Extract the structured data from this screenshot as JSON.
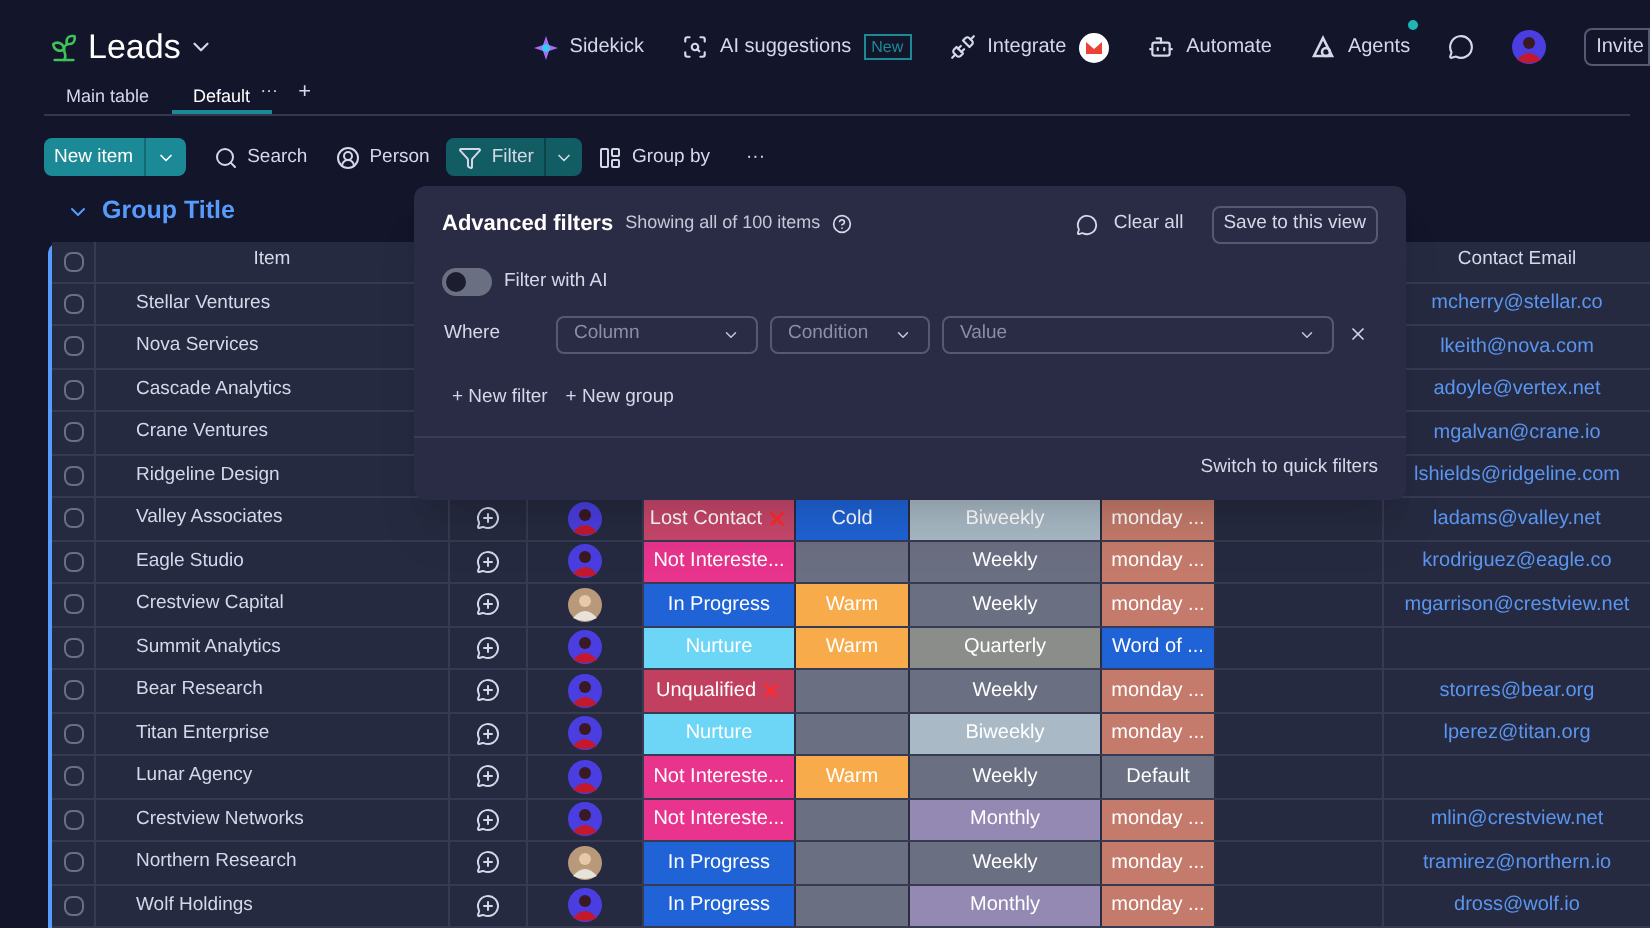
{
  "board": {
    "title": "Leads"
  },
  "top_actions": [
    {
      "label": "Sidekick",
      "kind": "sidekick"
    },
    {
      "label": "AI suggestions",
      "kind": "ai",
      "badge": "New"
    },
    {
      "label": "Integrate",
      "kind": "integrate"
    },
    {
      "label": "Automate",
      "kind": "automate"
    },
    {
      "label": "Agents",
      "kind": "agents"
    }
  ],
  "invite": "Invite",
  "views": [
    {
      "label": "Main table",
      "selected": false
    },
    {
      "label": "Default",
      "selected": true
    }
  ],
  "view_menu": "···",
  "add_view": "+",
  "toolbar": {
    "new_item": "New item",
    "more": "···",
    "items": [
      {
        "label": "Search",
        "kind": "search",
        "selected": false
      },
      {
        "label": "Person",
        "kind": "person",
        "selected": false
      },
      {
        "label": "Filter",
        "kind": "filter",
        "selected": true
      },
      {
        "label": "Group by",
        "kind": "group",
        "selected": false
      }
    ]
  },
  "group": {
    "title": "Group Title",
    "item_header": "Item",
    "email_header": "Contact Email",
    "all_checked": false,
    "rows": [
      {
        "name": "Stellar Ventures",
        "checked": false,
        "email": "mcherry@stellar.co"
      },
      {
        "name": "Nova Services",
        "checked": false,
        "email": "lkeith@nova.com"
      },
      {
        "name": "Cascade Analytics",
        "checked": false,
        "email": "adoyle@vertex.net"
      },
      {
        "name": "Crane Ventures",
        "checked": false,
        "email": "mgalvan@crane.io"
      },
      {
        "name": "Ridgeline Design",
        "checked": false,
        "email": "lshields@ridgeline.com"
      },
      {
        "name": "Valley Associates",
        "checked": false,
        "person": {
          "kind": "purple"
        },
        "status": {
          "label": "Lost Contact",
          "color": "#c8476b",
          "rejected": true
        },
        "temperature": {
          "label": "Cold",
          "color": "#1f63d6"
        },
        "frequency": {
          "label": "Biweekly",
          "color": "#a9bac6"
        },
        "source": {
          "label": "monday ...",
          "color": "#c57b6b"
        },
        "email": "ladams@valley.net"
      },
      {
        "name": "Eagle Studio",
        "checked": false,
        "person": {
          "kind": "purple"
        },
        "status": {
          "label": "Not Intereste...",
          "color": "#e8348c",
          "rejected": false
        },
        "temperature": {
          "color": "#6b6f82"
        },
        "frequency": {
          "label": "Weekly",
          "color": "#6b6f82"
        },
        "source": {
          "label": "monday ...",
          "color": "#c57b6b"
        },
        "email": "krodriguez@eagle.co"
      },
      {
        "name": "Crestview Capital",
        "checked": false,
        "person": {
          "kind": "photo"
        },
        "status": {
          "label": "In Progress",
          "color": "#1f63d6",
          "rejected": false
        },
        "temperature": {
          "label": "Warm",
          "color": "#f7ab4a"
        },
        "frequency": {
          "label": "Weekly",
          "color": "#6b6f82"
        },
        "source": {
          "label": "monday ...",
          "color": "#c57b6b"
        },
        "email": "mgarrison@crestview.net"
      },
      {
        "name": "Summit Analytics",
        "checked": false,
        "person": {
          "kind": "purple"
        },
        "status": {
          "label": "Nurture",
          "color": "#6dd6f7",
          "rejected": false
        },
        "temperature": {
          "label": "Warm",
          "color": "#f7ab4a"
        },
        "frequency": {
          "label": "Quarterly",
          "color": "#8a8d8a"
        },
        "source": {
          "label": "Word of ...",
          "color": "#1f63d6"
        }
      },
      {
        "name": "Bear Research",
        "checked": false,
        "person": {
          "kind": "purple"
        },
        "status": {
          "label": "Unqualified",
          "color": "#c2405f",
          "rejected": true
        },
        "temperature": {
          "color": "#6b6f82"
        },
        "frequency": {
          "label": "Weekly",
          "color": "#6b6f82"
        },
        "source": {
          "label": "monday ...",
          "color": "#c57b6b"
        },
        "email": "storres@bear.org"
      },
      {
        "name": "Titan Enterprise",
        "checked": false,
        "person": {
          "kind": "purple"
        },
        "status": {
          "label": "Nurture",
          "color": "#6dd6f7",
          "rejected": false
        },
        "temperature": {
          "color": "#6b6f82"
        },
        "frequency": {
          "label": "Biweekly",
          "color": "#a9bac6"
        },
        "source": {
          "label": "monday ...",
          "color": "#c57b6b"
        },
        "email": "lperez@titan.org"
      },
      {
        "name": "Lunar Agency",
        "checked": false,
        "person": {
          "kind": "purple"
        },
        "status": {
          "label": "Not Intereste...",
          "color": "#e8348c",
          "rejected": false
        },
        "temperature": {
          "label": "Warm",
          "color": "#f7ab4a"
        },
        "frequency": {
          "label": "Weekly",
          "color": "#6b6f82"
        },
        "source": {
          "label": "Default",
          "color": "#6b6f82"
        }
      },
      {
        "name": "Crestview Networks",
        "checked": false,
        "person": {
          "kind": "purple"
        },
        "status": {
          "label": "Not Intereste...",
          "color": "#e8348c",
          "rejected": false
        },
        "temperature": {
          "color": "#6b6f82"
        },
        "frequency": {
          "label": "Monthly",
          "color": "#9489b3"
        },
        "source": {
          "label": "monday ...",
          "color": "#c57b6b"
        },
        "email": "mlin@crestview.net"
      },
      {
        "name": "Northern Research",
        "checked": false,
        "person": {
          "kind": "photo"
        },
        "status": {
          "label": "In Progress",
          "color": "#1f63d6",
          "rejected": false
        },
        "temperature": {
          "color": "#6b6f82"
        },
        "frequency": {
          "label": "Weekly",
          "color": "#6b6f82"
        },
        "source": {
          "label": "monday ...",
          "color": "#c57b6b"
        },
        "email": "tramirez@northern.io"
      },
      {
        "name": "Wolf Holdings",
        "checked": false,
        "person": {
          "kind": "purple"
        },
        "status": {
          "label": "In Progress",
          "color": "#1f63d6",
          "rejected": false
        },
        "temperature": {
          "color": "#6b6f82"
        },
        "frequency": {
          "label": "Monthly",
          "color": "#9489b3"
        },
        "source": {
          "label": "monday ...",
          "color": "#c57b6b"
        },
        "email": "dross@wolf.io"
      }
    ]
  },
  "filter_panel": {
    "title": "Advanced filters",
    "summary": "Showing all of 100 items",
    "clear": "Clear all",
    "save": "Save to this view",
    "ai_toggle": {
      "label": "Filter with AI",
      "on": false
    },
    "where": "Where",
    "fields": [
      {
        "placeholder": "Column"
      },
      {
        "placeholder": "Condition"
      },
      {
        "placeholder": "Value"
      }
    ],
    "links": [
      "+ New filter",
      "+ New group"
    ],
    "switch": "Switch to quick filters"
  }
}
